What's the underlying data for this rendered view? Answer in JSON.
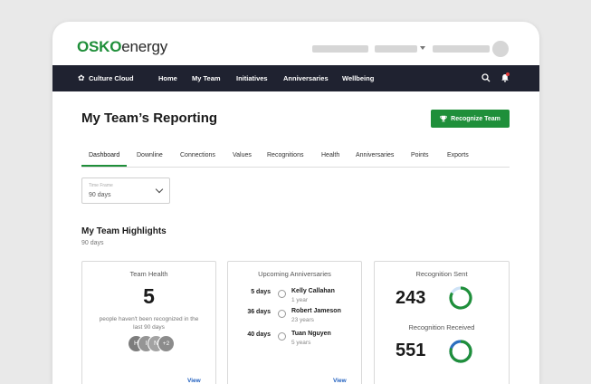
{
  "brand": {
    "name_bold": "OSKO",
    "name_rest": "energy"
  },
  "nav": {
    "brand": "Culture Cloud",
    "items": [
      "Home",
      "My Team",
      "Initiatives",
      "Anniversaries",
      "Wellbeing"
    ],
    "icons": [
      "search-icon",
      "bell-icon"
    ]
  },
  "page": {
    "title": "My Team’s Reporting",
    "recognize_button": "Recognize Team",
    "tabs": [
      "Dashboard",
      "Downline",
      "Connections",
      "Values",
      "Recognitions",
      "Health",
      "Anniversaries",
      "Points",
      "Exports"
    ],
    "active_tab": "Dashboard",
    "timeframe": {
      "label": "Time Frame",
      "value": "90 days"
    },
    "highlights": {
      "title": "My Team Highlights",
      "subtitle": "90 days"
    }
  },
  "cards": {
    "health": {
      "title": "Team Health",
      "value": "5",
      "desc": "people haven't been recognized in the last 90 days",
      "avatars": [
        "H",
        "I",
        "N"
      ],
      "more": "+2",
      "view": "View"
    },
    "anniversaries": {
      "title": "Upcoming Anniversaries",
      "rows": [
        {
          "days": "5 days",
          "name": "Kelly Callahan",
          "years": "1 year"
        },
        {
          "days": "36 days",
          "name": "Robert Jameson",
          "years": "23 years"
        },
        {
          "days": "40 days",
          "name": "Tuan Nguyen",
          "years": "5 years"
        }
      ],
      "view": "View"
    },
    "recognition": {
      "sent_title": "Recognition Sent",
      "sent_value": "243",
      "received_title": "Recognition Received",
      "received_value": "551"
    }
  },
  "colors": {
    "brand_green": "#1f8f3a",
    "nav_dark": "#1f2230",
    "link_blue": "#1f5fbf"
  }
}
